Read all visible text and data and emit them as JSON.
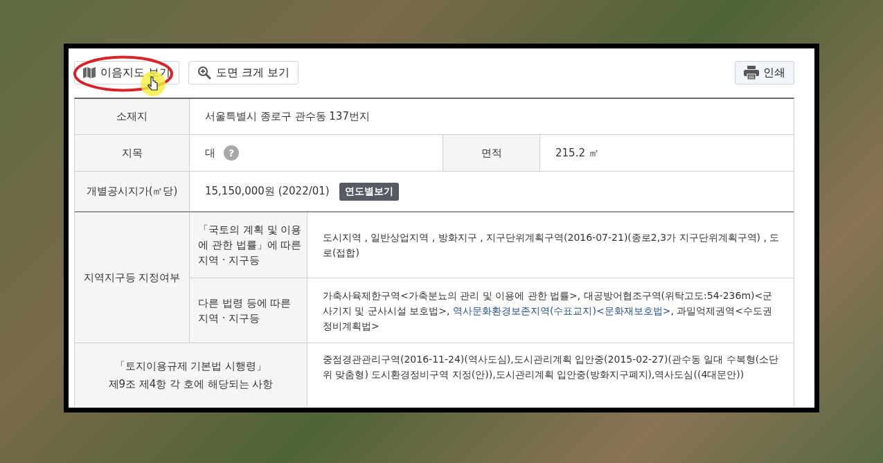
{
  "toolbar": {
    "left_buttons": [
      {
        "kind": "map",
        "label": "이음지도 보기"
      },
      {
        "kind": "zoom",
        "label": "도면 크게 보기"
      }
    ],
    "print_button": {
      "label": "인쇄"
    }
  },
  "table": {
    "location": {
      "header": "소재지",
      "value": "서울특별시 종로구 관수동 137번지"
    },
    "land_category": {
      "header": "지목",
      "value": "대",
      "help": "?"
    },
    "area": {
      "header": "면적",
      "value": "215.2 ㎡"
    },
    "land_price": {
      "header": "개별공시지가(㎡당)",
      "value": "15,150,000원 (2022/01)",
      "button": "연도별보기"
    },
    "zoning": {
      "header": "지역지구등 지정여부",
      "rows": [
        {
          "header_lines": [
            "「국토의 계획 및 이용",
            "에 관한 법률」에 따른",
            "지역 · 지구등"
          ],
          "segments": [
            {
              "text": "도시지역 , 일반상업지역 , 방화지구 , 지구단위계획구역(2016-07-21)(종로2,3가 지구단위계획구역) , 도로(접합)",
              "highlighted": false
            }
          ]
        },
        {
          "header_lines": [
            "다른 법령 등에 따른",
            "지역 · 지구등"
          ],
          "segments": [
            {
              "text": "가축사육제한구역<가축분뇨의 관리 및 이용에 관한 법률>, 대공방어협조구역(위탁고도:54-236m)<군사기지 및 군사시설 보호법>, ",
              "highlighted": false
            },
            {
              "text": "역사문화환경보존지역(수표교지)<문화재보호법>",
              "highlighted": true
            },
            {
              "text": ", 과밀억제권역<수도권정비계획법>",
              "highlighted": false
            }
          ]
        }
      ]
    },
    "regulation": {
      "header_lines": [
        "「토지이용규제 기본법 시행령」",
        "제9조 제4항 각 호에 해당되는 사항"
      ],
      "value": "중점경관관리구역(2016-11-24)(역사도심),도시관리계획 입안중(2015-02-27)(관수동 일대 수복형(소단위 맞춤형) 도시환경정비구역 지정(안)),도시관리계획 입안중(방화지구폐지),역사도심((4대문안))"
    }
  }
}
